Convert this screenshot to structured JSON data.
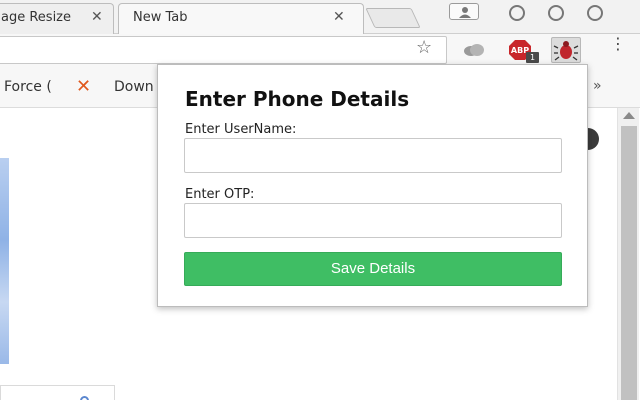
{
  "tabs": [
    {
      "label": "age Resize",
      "close": "✕"
    },
    {
      "label": "New Tab",
      "close": "✕"
    }
  ],
  "toolbar": {
    "star_icon": "star-icon",
    "extensions": [
      "cloud-extension-icon",
      "adblock-extension-icon",
      "bug-extension-icon"
    ],
    "abp_badge": "1",
    "menu_glyph": "⋮"
  },
  "bookmarks": {
    "items": [
      "Force (",
      "Down"
    ],
    "more": "»"
  },
  "popup": {
    "title": "Enter Phone Details",
    "username_label": "Enter UserName:",
    "username_value": "",
    "otp_label": "Enter OTP:",
    "otp_value": "",
    "save_label": "Save Details"
  },
  "colors": {
    "save_button": "#3fbe64",
    "bookmark_x": "#e0581d"
  }
}
